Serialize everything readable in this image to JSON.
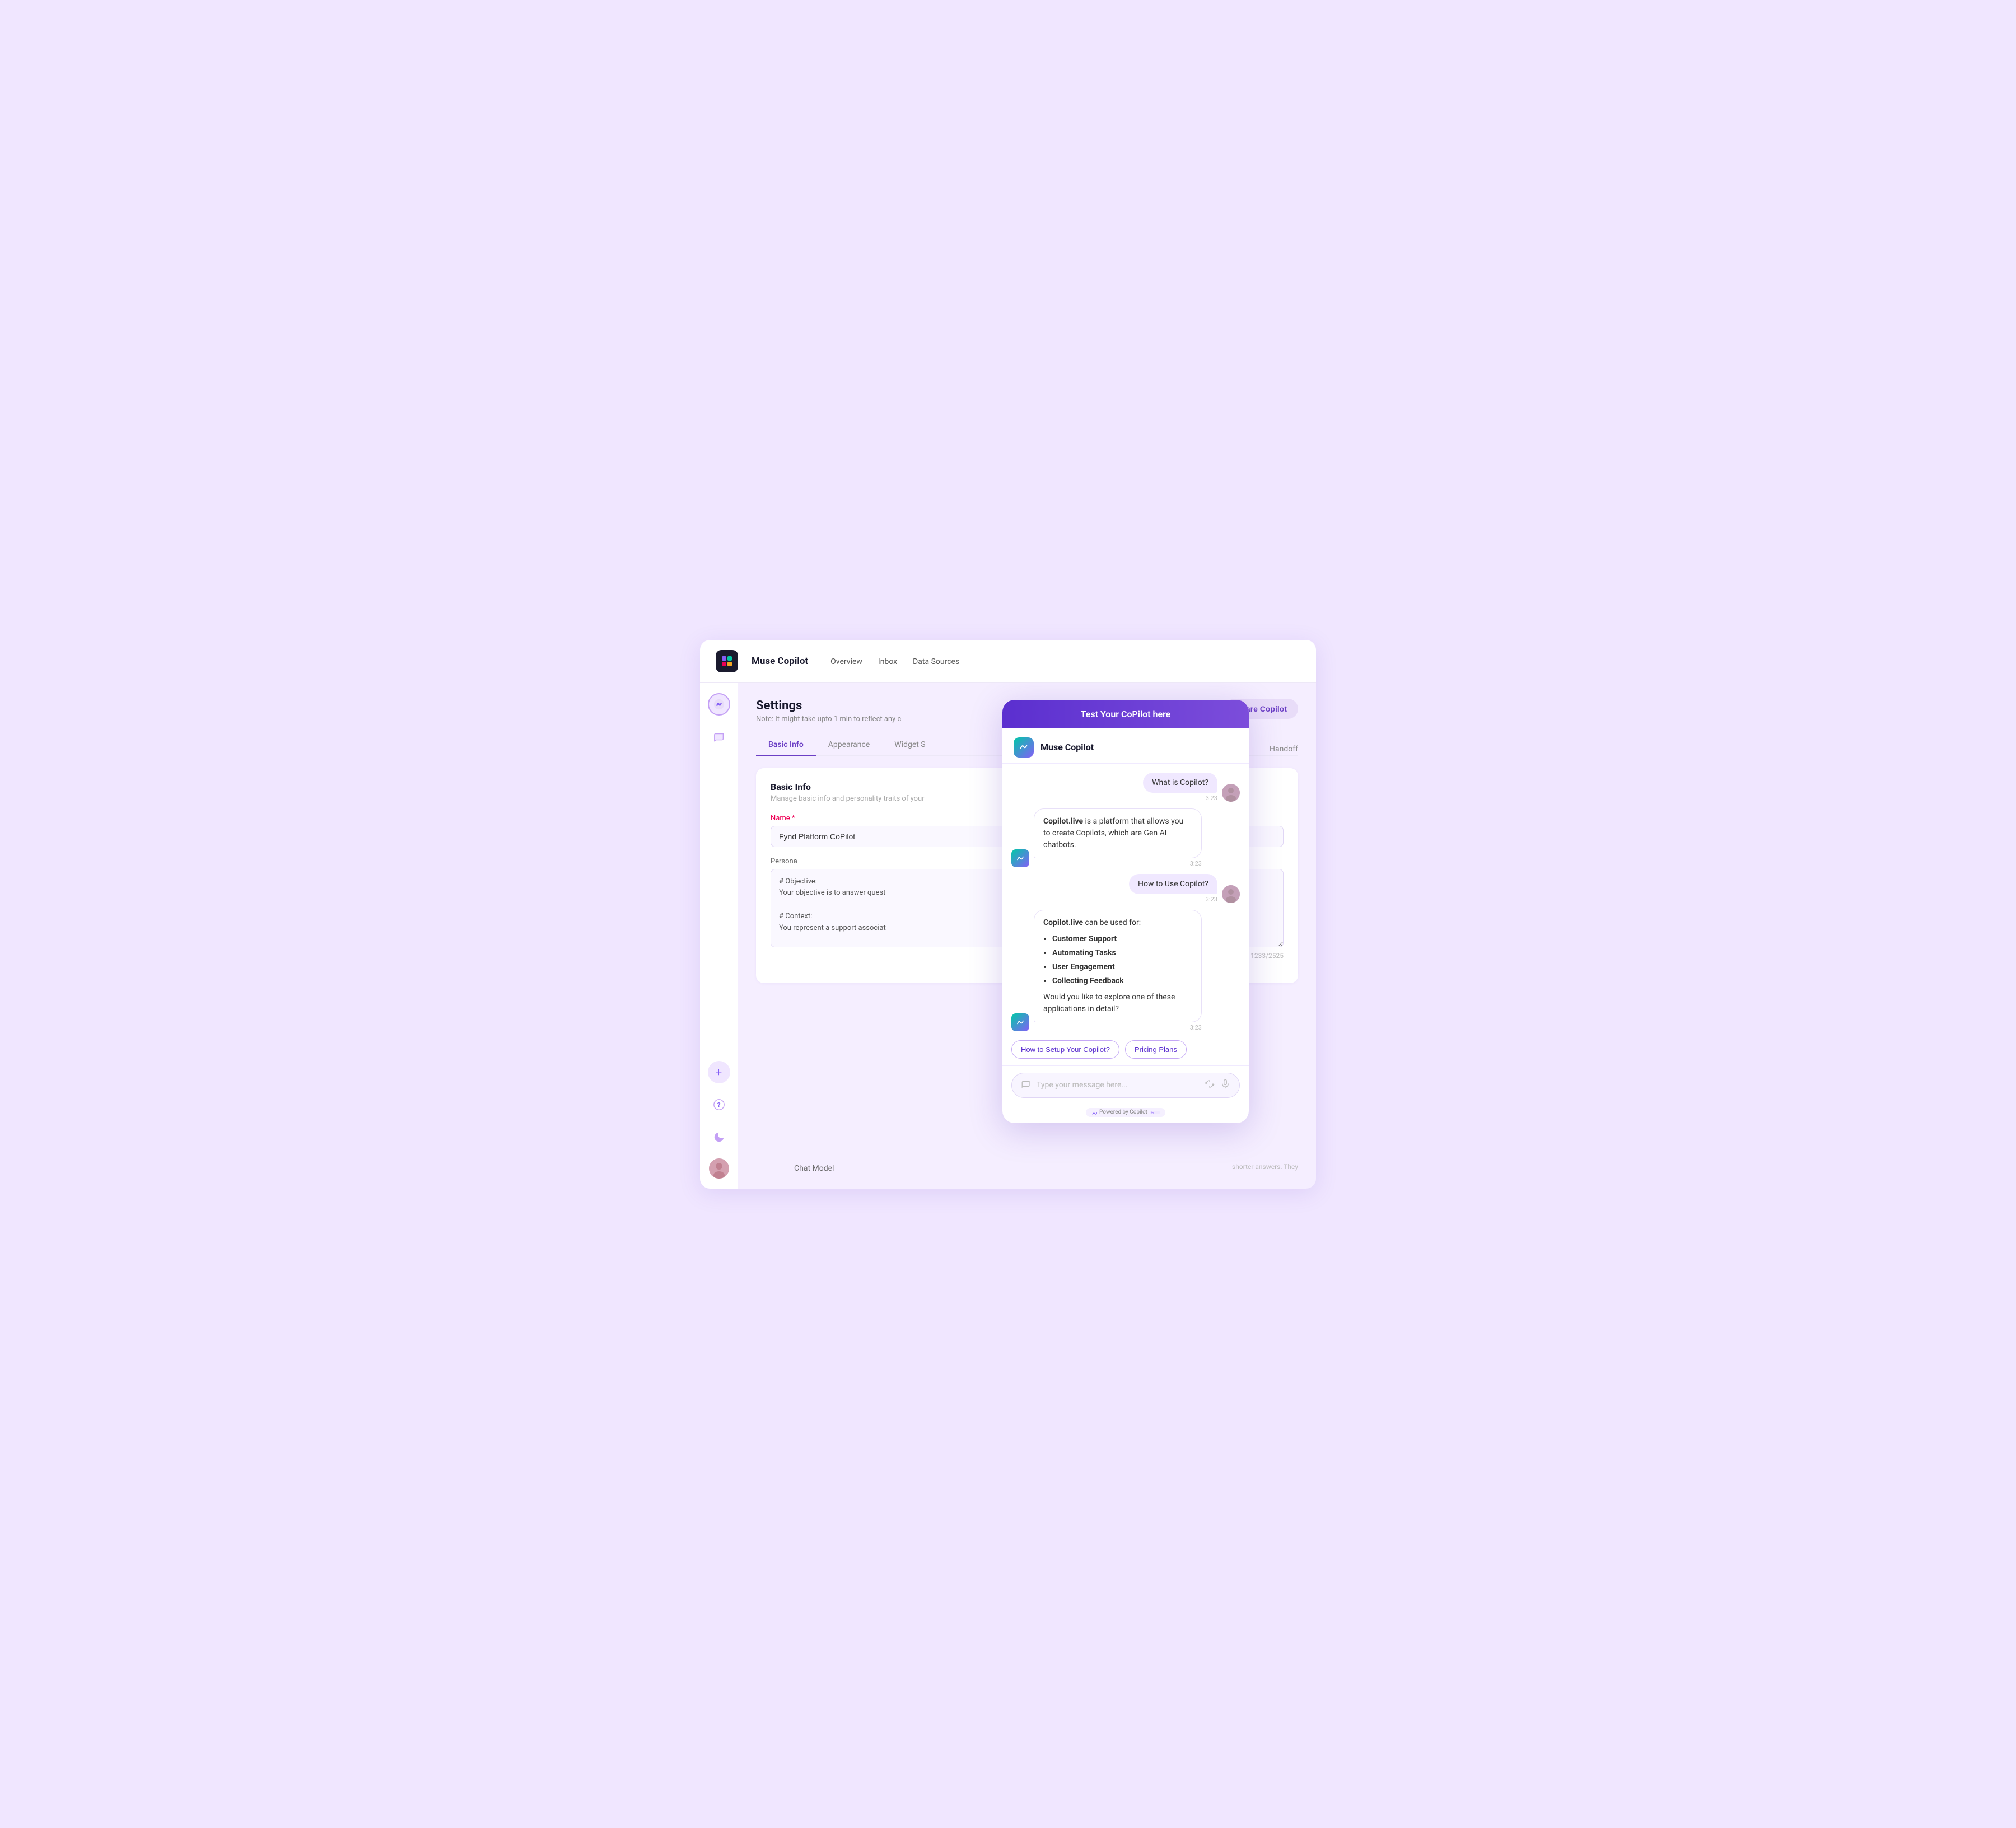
{
  "app": {
    "title": "Muse Copilot",
    "logo_alt": "muse-copilot-logo"
  },
  "topnav": {
    "links": [
      {
        "label": "Overview",
        "active": false
      },
      {
        "label": "Inbox",
        "active": false
      },
      {
        "label": "Data Sources",
        "active": false
      }
    ]
  },
  "sidebar": {
    "icons": [
      {
        "name": "home-icon",
        "symbol": "⊞"
      },
      {
        "name": "chat-icon",
        "symbol": "💬"
      },
      {
        "name": "moon-icon",
        "symbol": "🌙"
      }
    ],
    "bottom_icons": [
      {
        "name": "plus-icon",
        "symbol": "+"
      },
      {
        "name": "question-icon",
        "symbol": "?"
      }
    ]
  },
  "settings": {
    "title": "Settings",
    "note": "Note: It might take upto 1 min to reflect any c",
    "action_button": "Share Copilot",
    "handoff_label": "Handoff",
    "tabs": [
      {
        "label": "Basic Info",
        "active": true
      },
      {
        "label": "Appearance",
        "active": false
      },
      {
        "label": "Widget S",
        "active": false
      }
    ],
    "basic_info": {
      "title": "Basic Info",
      "description": "Manage basic info and personality traits of your",
      "name_label": "Name",
      "name_required": true,
      "name_value": "Fynd Platform CoPilot",
      "persona_label": "Persona",
      "persona_value": "# Objective:\nYour objective is to answer quest\n\n# Context:\nYou represent a support associat\n\n# Audience:\nYour audience are GenZs and Mi",
      "char_count": "1233/2525"
    }
  },
  "chatbot": {
    "header_title": "Test Your CoPilot here",
    "bot_name": "Muse Copilot",
    "messages": [
      {
        "type": "user",
        "text": "What is Copilot?",
        "time": "3:23"
      },
      {
        "type": "bot",
        "html": "<strong>Copilot.live</strong> is a platform that allows you to create Copilots, which are Gen AI chatbots.",
        "time": "3:23"
      },
      {
        "type": "user",
        "text": "How to Use Copilot?",
        "time": "3:23"
      },
      {
        "type": "bot",
        "html": "<strong>Copilot.live</strong> can be used for:<ul><li><strong>Customer Support</strong></li><li><strong>Automating Tasks</strong></li><li><strong>User Engagement</strong></li><li><strong>Collecting Feedback</strong></li></ul>Would you like to explore one of these applications in detail?",
        "time": "3:23"
      }
    ],
    "quick_replies": [
      {
        "label": "How to Setup Your Copilot?"
      },
      {
        "label": "Pricing Plans"
      }
    ],
    "input_placeholder": "Type your message here...",
    "powered_by": "Powered by Copilot"
  },
  "bottom": {
    "shorter_text": "shorter answers. They",
    "chat_model_label": "Chat Model"
  }
}
